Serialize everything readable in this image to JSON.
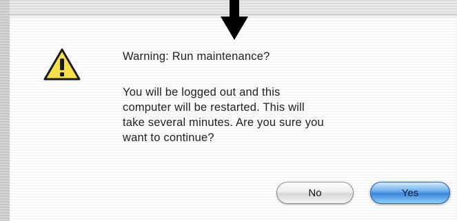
{
  "dialog": {
    "title": "Warning: Run maintenance?",
    "message_lines": [
      "You will be logged out and this",
      "computer will be restarted.  This will",
      "take several minutes. Are you sure you",
      "want to continue?"
    ],
    "icon": "warning-triangle-icon",
    "buttons": {
      "no_label": "No",
      "yes_label": "Yes",
      "default": "yes"
    }
  },
  "annotation": {
    "icon": "down-arrow-icon"
  },
  "colors": {
    "warning_yellow": "#f7e04a",
    "default_button_blue": "#3b86d9",
    "text": "#222222"
  }
}
